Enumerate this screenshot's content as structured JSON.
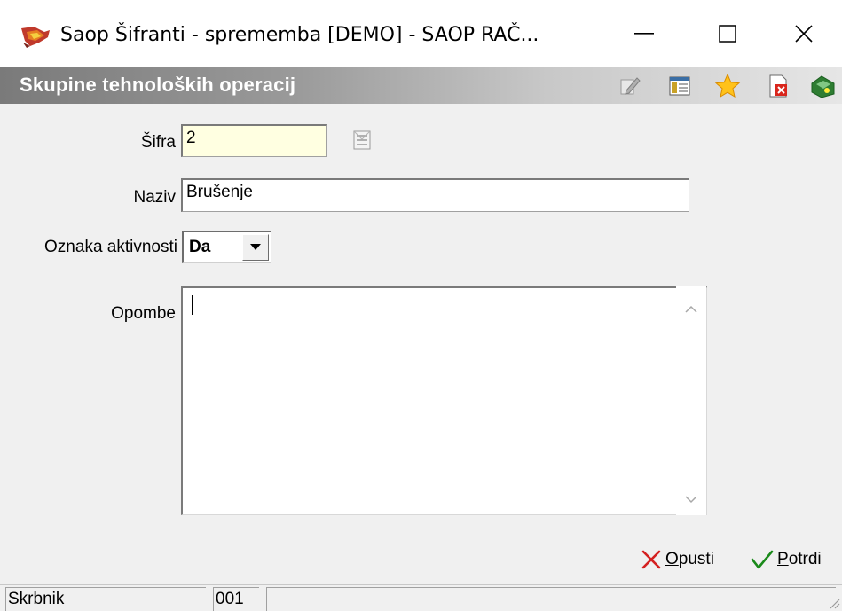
{
  "window": {
    "title": "Saop Šifranti - sprememba [DEMO] - SAOP RAČ...",
    "minimize_glyph": "—",
    "maximize_glyph": "☐",
    "close_glyph": "✕"
  },
  "header": {
    "title": "Skupine tehnoloških operacij",
    "icons": [
      "edit-icon",
      "columns-icon",
      "favorite-star-icon",
      "close-document-icon",
      "exit-icon"
    ]
  },
  "form": {
    "sifra": {
      "label": "Šifra",
      "value": "2"
    },
    "naziv": {
      "label": "Naziv",
      "value": "Brušenje"
    },
    "oznaka_aktivnosti": {
      "label": "Oznaka aktivnosti",
      "value": "Da"
    },
    "opombe": {
      "label": "Opombe",
      "value": ""
    }
  },
  "actions": {
    "cancel": {
      "underline": "O",
      "rest": "pusti"
    },
    "confirm": {
      "underline": "P",
      "rest": "otrdi"
    }
  },
  "statusbar": {
    "user": "Skrbnik",
    "code": "001",
    "info": ""
  },
  "colors": {
    "field_yellow": "#ffffe1",
    "cancel_red": "#d42020",
    "confirm_green": "#1a8a1a"
  }
}
